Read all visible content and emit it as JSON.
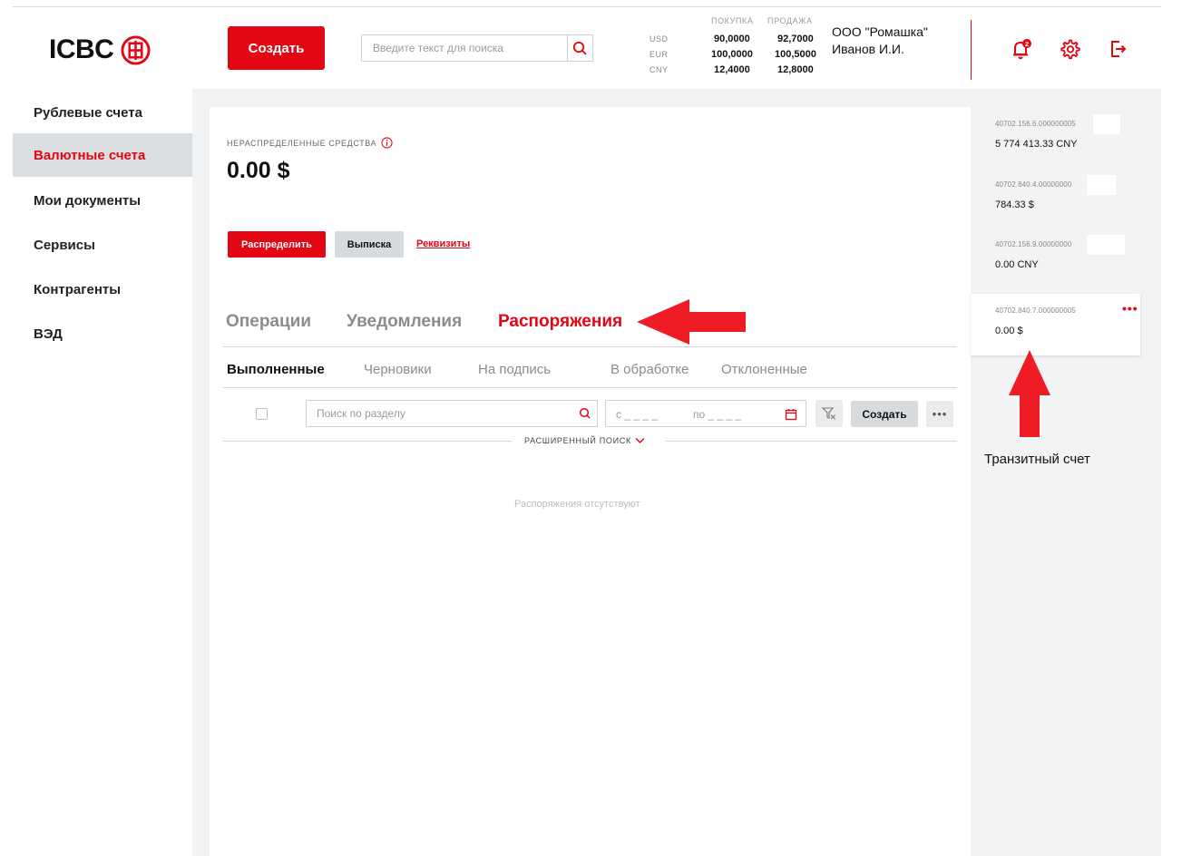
{
  "header": {
    "logo_text": "ICBC",
    "create_label": "Создать",
    "search_placeholder": "Введите текст для поиска",
    "rates": {
      "buy_label": "ПОКУПКА",
      "sell_label": "ПРОДАЖА",
      "rows": [
        {
          "currency": "USD",
          "buy": "90,0000",
          "sell": "92,7000"
        },
        {
          "currency": "EUR",
          "buy": "100,0000",
          "sell": "100,5000"
        },
        {
          "currency": "CNY",
          "buy": "12,4000",
          "sell": "12,8000"
        }
      ]
    },
    "company": "ООО \"Ромашка\"",
    "user": "Иванов И.И.",
    "notifications_count": "2"
  },
  "sidebar": {
    "items": [
      {
        "label": "Рублевые счета"
      },
      {
        "label": "Валютные счета"
      },
      {
        "label": "Мои документы"
      },
      {
        "label": "Сервисы"
      },
      {
        "label": "Контрагенты"
      },
      {
        "label": "ВЭД"
      }
    ],
    "active_index": 1
  },
  "main": {
    "undistributed_label": "НЕРАСПРЕДЕЛЕННЫЕ СРЕДСТВА",
    "amount": "0.00 $",
    "distribute_label": "Распределить",
    "statement_label": "Выписка",
    "requisites_label": "Реквизиты",
    "tabs": [
      {
        "label": "Операции"
      },
      {
        "label": "Уведомления"
      },
      {
        "label": "Распоряжения"
      }
    ],
    "subtabs": [
      {
        "label": "Выполненные"
      },
      {
        "label": "Черновики"
      },
      {
        "label": "На подпись"
      },
      {
        "label": "В обработке"
      },
      {
        "label": "Отклоненные"
      }
    ],
    "section_search_placeholder": "Поиск по разделу",
    "date_from": "с _ _ _ _",
    "date_to": "по _ _ _ _",
    "create_label": "Создать",
    "advanced_search_label": "РАСШИРЕННЫЙ ПОИСК",
    "empty_text": "Распоряжения отсутствуют"
  },
  "accounts": [
    {
      "number": "40702.156.6.000000005",
      "amount": "5 774 413.33 CNY"
    },
    {
      "number": "40702.840.4.00000000",
      "amount": "784.33 $"
    },
    {
      "number": "40702.156.9.00000000",
      "amount": "0.00 CNY"
    },
    {
      "number": "40702.840.7.000000005",
      "amount": "0.00 $"
    }
  ],
  "annotation": {
    "transit_label": "Транзитный счет"
  },
  "colors": {
    "brand": "#e30613",
    "active_bg": "#dcdfe2",
    "page_bg": "#f2f3f5"
  }
}
